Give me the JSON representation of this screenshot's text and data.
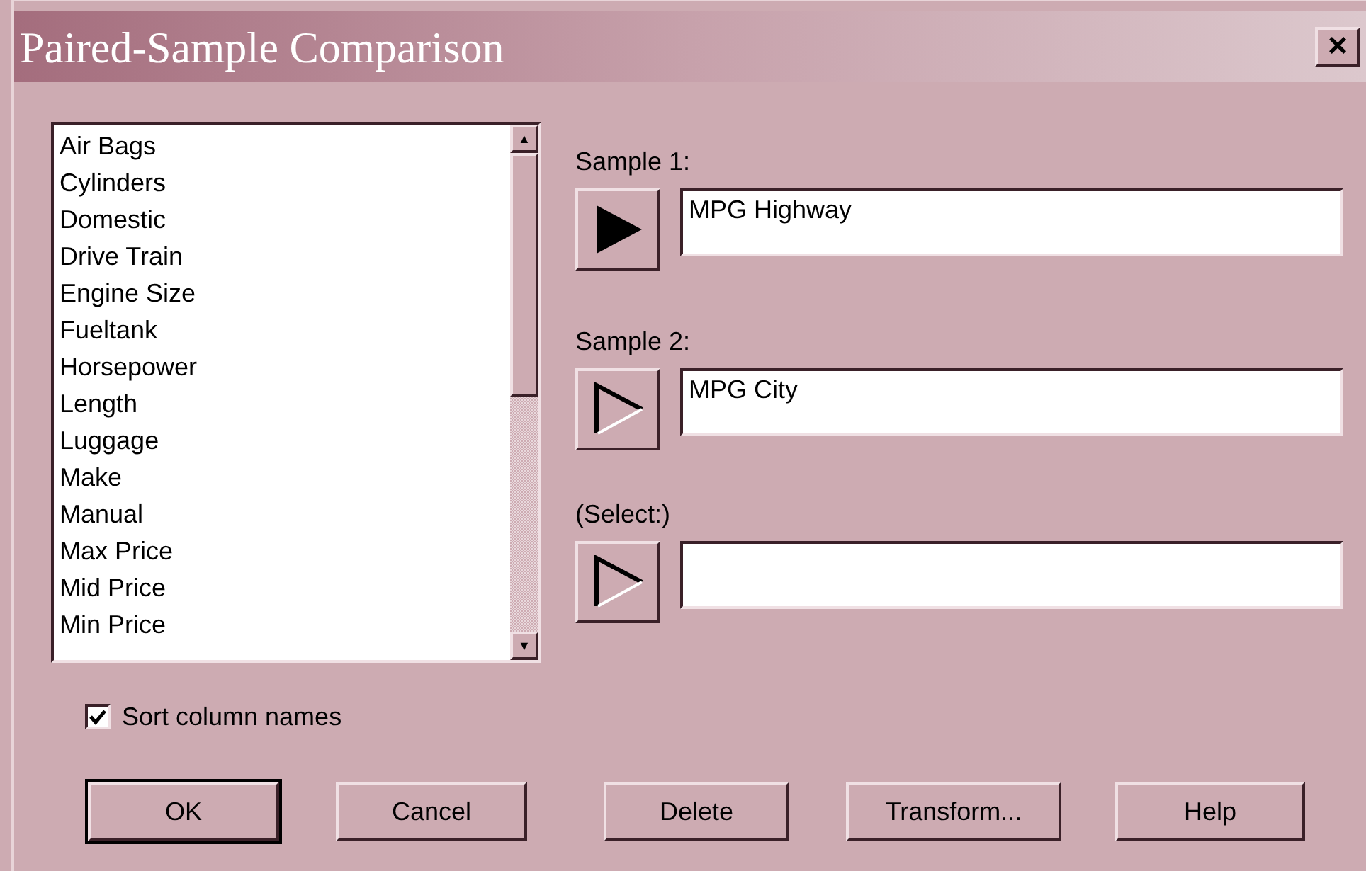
{
  "window": {
    "title": "Paired-Sample Comparison",
    "close": "×"
  },
  "columns": {
    "items": [
      "Air Bags",
      "Cylinders",
      "Domestic",
      "Drive Train",
      "Engine Size",
      "Fueltank",
      "Horsepower",
      "Length",
      "Luggage",
      "Make",
      "Manual",
      "Max Price",
      "Mid Price",
      "Min Price"
    ],
    "scroll_up": "▲",
    "scroll_down": "▼"
  },
  "inputs": [
    {
      "label": "Sample 1:",
      "value": "MPG Highway",
      "selected": true
    },
    {
      "label": "Sample 2:",
      "value": "MPG City",
      "selected": false
    },
    {
      "label": "(Select:)",
      "selected": false
    }
  ],
  "sort_columns": {
    "label": "Sort column names",
    "checked": true
  },
  "buttons": [
    {
      "label": "OK",
      "default": true
    },
    {
      "label": "Cancel",
      "default": false
    },
    {
      "label": "Delete",
      "default": false
    },
    {
      "label": "Transform...",
      "default": false
    },
    {
      "label": "Help",
      "default": false
    }
  ]
}
